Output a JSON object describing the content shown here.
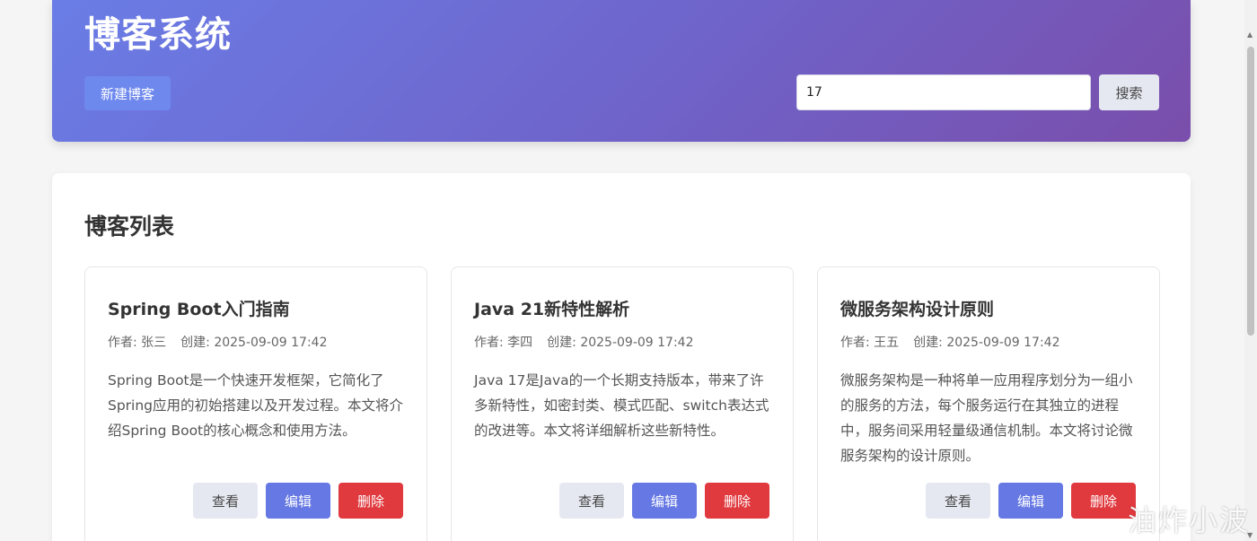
{
  "header": {
    "title": "博客系统",
    "new_button": "新建博客",
    "search_value": "17",
    "search_button": "搜索"
  },
  "list": {
    "title": "博客列表",
    "cards": [
      {
        "title": "Spring Boot入门指南",
        "author": "作者: 张三",
        "created": "创建: 2025-09-09 17:42",
        "summary": "Spring Boot是一个快速开发框架，它简化了Spring应用的初始搭建以及开发过程。本文将介绍Spring Boot的核心概念和使用方法。",
        "view": "查看",
        "edit": "编辑",
        "delete": "删除"
      },
      {
        "title": "Java 21新特性解析",
        "author": "作者: 李四",
        "created": "创建: 2025-09-09 17:42",
        "summary": "Java 17是Java的一个长期支持版本，带来了许多新特性，如密封类、模式匹配、switch表达式的改进等。本文将详细解析这些新特性。",
        "view": "查看",
        "edit": "编辑",
        "delete": "删除"
      },
      {
        "title": "微服务架构设计原则",
        "author": "作者: 王五",
        "created": "创建: 2025-09-09 17:42",
        "summary": "微服务架构是一种将单一应用程序划分为一组小的服务的方法，每个服务运行在其独立的进程中，服务间采用轻量级通信机制。本文将讨论微服务架构的设计原则。",
        "view": "查看",
        "edit": "编辑",
        "delete": "删除"
      }
    ]
  },
  "watermark": "油炸小波",
  "colors": {
    "header_gradient_start": "#6a7de6",
    "header_gradient_end": "#7a4eab",
    "edit_button": "#6578e3",
    "delete_button": "#e0393e",
    "view_button": "#e5e8f0"
  }
}
